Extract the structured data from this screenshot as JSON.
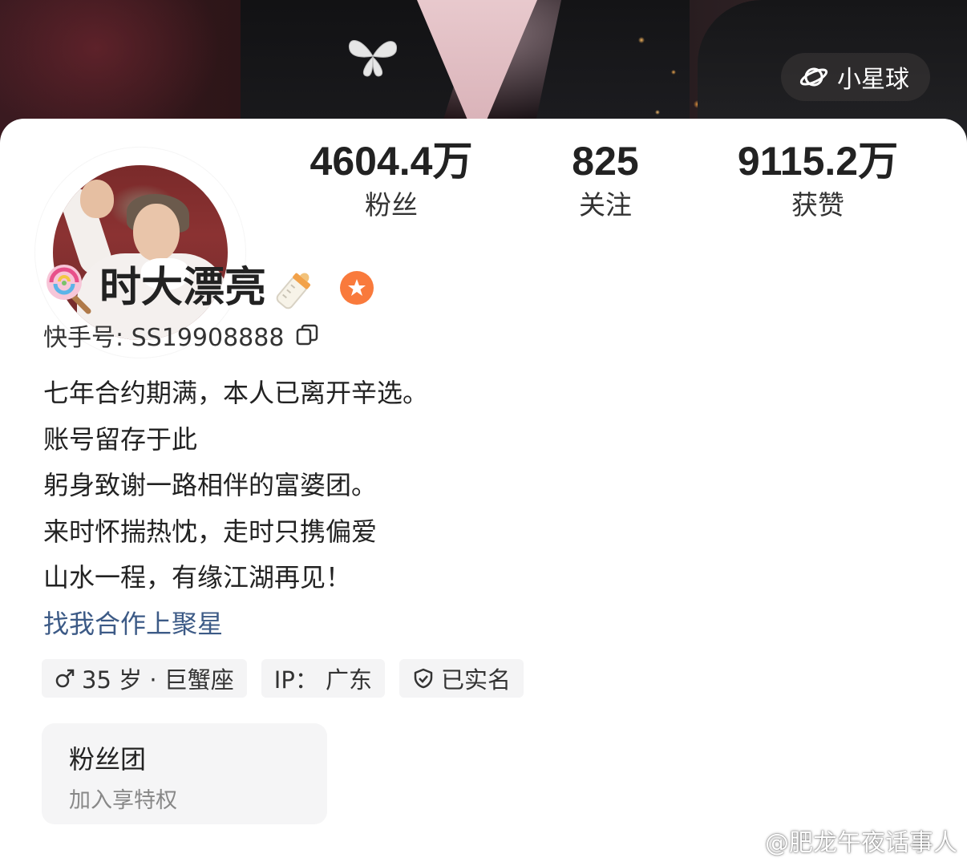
{
  "header": {
    "planet_label": "小星球",
    "planet_icon": "planet-icon"
  },
  "profile": {
    "name": "时大漂亮",
    "name_prefix_emoji": "🍭",
    "name_suffix_emoji": "🍼",
    "id_label": "快手号: SS19908888",
    "copy_icon": "copy-icon",
    "badge_color": "#f97a3c"
  },
  "stats": {
    "followers": {
      "value": "4604.4万",
      "label": "粉丝"
    },
    "following": {
      "value": "825",
      "label": "关注"
    },
    "likes": {
      "value": "9115.2万",
      "label": "获赞"
    }
  },
  "bio": {
    "lines": [
      "七年合约期满，本人已离开辛选。",
      "账号留存于此",
      "躬身致谢一路相伴的富婆团。",
      "来时怀揣热忱，走时只携偏爱",
      "山水一程，有缘江湖再见！"
    ],
    "link": "找我合作上聚星",
    "link_color": "#3c5a86"
  },
  "tags": [
    {
      "icon": "male-icon",
      "text": "35 岁 · 巨蟹座"
    },
    {
      "icon": "",
      "text": "IP：  广东"
    },
    {
      "icon": "shield-check-icon",
      "text": "已实名"
    }
  ],
  "fan_club": {
    "title": "粉丝团",
    "subtitle": "加入享特权"
  },
  "watermark": {
    "text": "@肥龙午夜话事人",
    "icon": "weibo-icon"
  }
}
